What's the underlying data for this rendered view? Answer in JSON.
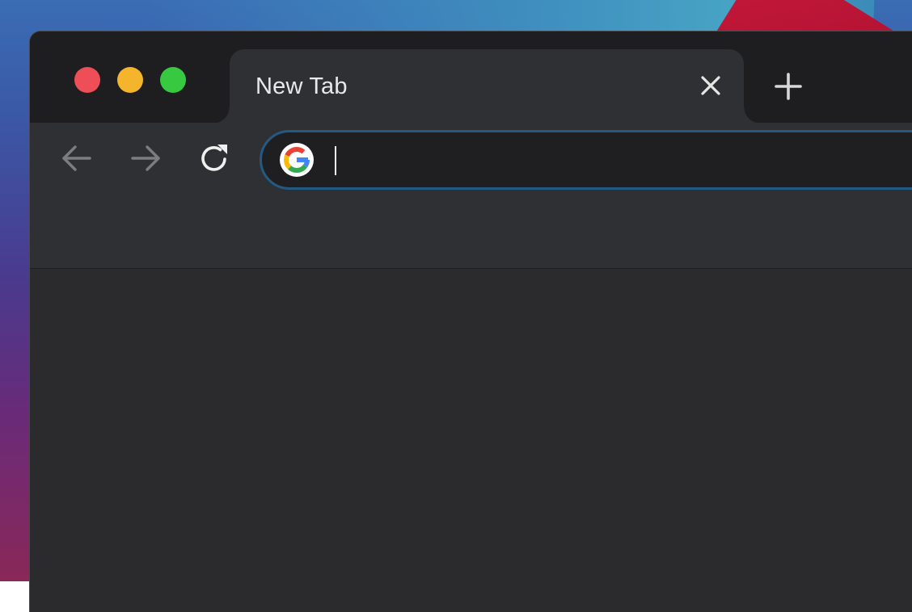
{
  "window": {
    "traffic_lights": {
      "close_color": "#ee4e57",
      "minimize_color": "#f4b42c",
      "zoom_color": "#37c93f"
    },
    "tab": {
      "title": "New Tab",
      "close_icon": "close-icon"
    },
    "new_tab_icon": "plus-icon"
  },
  "toolbar": {
    "back_icon": "arrow-left-icon",
    "forward_icon": "arrow-right-icon",
    "reload_icon": "reload-icon",
    "address_bar": {
      "value": "",
      "search_engine_icon": "google-icon",
      "focus_color": "#245a82"
    }
  }
}
